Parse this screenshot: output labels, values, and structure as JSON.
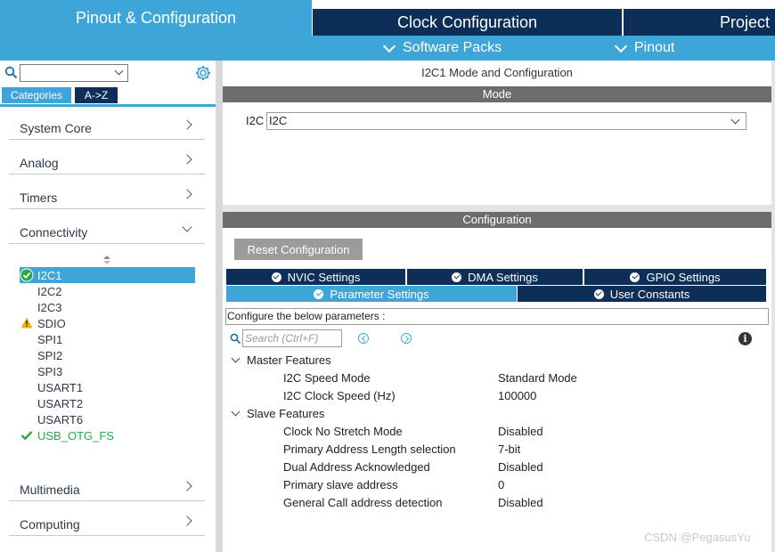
{
  "top_tabs": {
    "pinout": "Pinout & Configuration",
    "clock": "Clock Configuration",
    "project": "Project"
  },
  "subbar": {
    "software_packs": "Software Packs",
    "pinout": "Pinout"
  },
  "left": {
    "search_value": "",
    "tabs": [
      "Categories",
      "A->Z"
    ],
    "categories": [
      "System Core",
      "Analog",
      "Timers",
      "Connectivity",
      "Multimedia",
      "Computing"
    ],
    "peripherals": [
      "I2C1",
      "I2C2",
      "I2C3",
      "SDIO",
      "SPI1",
      "SPI2",
      "SPI3",
      "USART1",
      "USART2",
      "USART6",
      "USB_OTG_FS"
    ]
  },
  "main": {
    "title": "I2C1 Mode and Configuration",
    "mode_header": "Mode",
    "i2c_label": "I2C",
    "i2c_value": "I2C",
    "config_header": "Configuration",
    "reset_button": "Reset Configuration",
    "tabs_row1": [
      "NVIC Settings",
      "DMA Settings",
      "GPIO Settings"
    ],
    "tabs_row2": [
      "Parameter Settings",
      "User Constants"
    ],
    "config_note": "Configure the below parameters :",
    "search_placeholder": "Search (Ctrl+F)",
    "groups": [
      {
        "name": "Master Features",
        "params": [
          {
            "name": "I2C Speed Mode",
            "value": "Standard Mode"
          },
          {
            "name": "I2C Clock Speed (Hz)",
            "value": "100000"
          }
        ]
      },
      {
        "name": "Slave Features",
        "params": [
          {
            "name": "Clock No Stretch Mode",
            "value": "Disabled"
          },
          {
            "name": "Primary Address Length selection",
            "value": "7-bit"
          },
          {
            "name": "Dual Address Acknowledged",
            "value": "Disabled"
          },
          {
            "name": "Primary slave address",
            "value": "0"
          },
          {
            "name": "General Call address detection",
            "value": "Disabled"
          }
        ]
      }
    ]
  },
  "watermark": "CSDN @PegasusYu",
  "colors": {
    "accent": "#3ea5d8",
    "navy": "#0c2e57",
    "section_grey": "#6d6d6d",
    "ok_green": "#2aa84a",
    "warn_yellow": "#f0b400"
  }
}
